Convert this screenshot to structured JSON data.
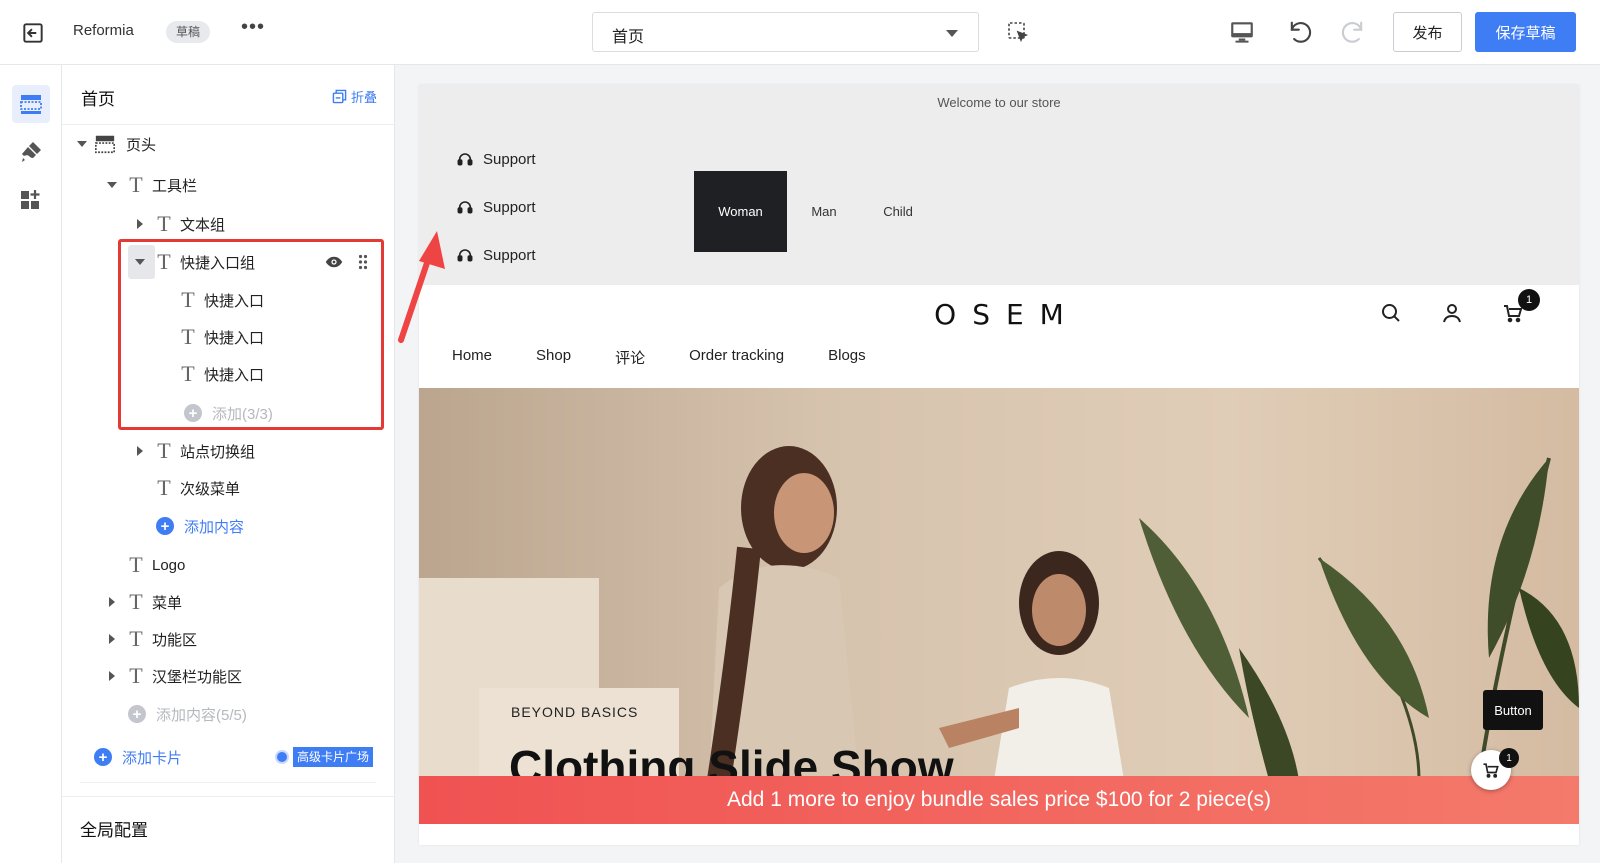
{
  "topbar": {
    "app_name": "Reformia",
    "status_badge": "草稿",
    "more": "•••",
    "page_select": "首页",
    "publish": "发布",
    "save_draft": "保存草稿"
  },
  "panel": {
    "title": "首页",
    "collapse": "折叠",
    "tree": {
      "header": "页头",
      "toolbar": "工具栏",
      "text_group": "文本组",
      "quick_entry_group": "快捷入口组",
      "quick_entries": [
        "快捷入口",
        "快捷入口",
        "快捷入口"
      ],
      "add_limited": "添加(3/3)",
      "site_switch_group": "站点切换组",
      "sub_menu": "次级菜单",
      "add_content": "添加内容",
      "logo": "Logo",
      "menu": "菜单",
      "function_area": "功能区",
      "hamburger_area": "汉堡栏功能区",
      "add_content_limited": "添加内容(5/5)"
    },
    "add_card": "添加卡片",
    "pro_card_market": "高级卡片广场",
    "global_config": "全局配置"
  },
  "preview": {
    "welcome": "Welcome to our store",
    "support_links": [
      "Support",
      "Support",
      "Support"
    ],
    "category_tabs": [
      "Woman",
      "Man",
      "Child"
    ],
    "logo": "OSEM",
    "cart_count": "1",
    "nav": [
      "Home",
      "Shop",
      "评论",
      "Order tracking",
      "Blogs"
    ],
    "hero_kicker": "BEYOND BASICS",
    "hero_title": "Clothing Slide Show",
    "float_button": "Button",
    "float_cart_count": "1",
    "bundle_message": "Add 1 more to enjoy bundle sales price $100 for 2 piece(s)"
  },
  "colors": {
    "primary": "#3f7df4",
    "annotation_red": "#e53935",
    "bundle_bar": "#f05252"
  }
}
